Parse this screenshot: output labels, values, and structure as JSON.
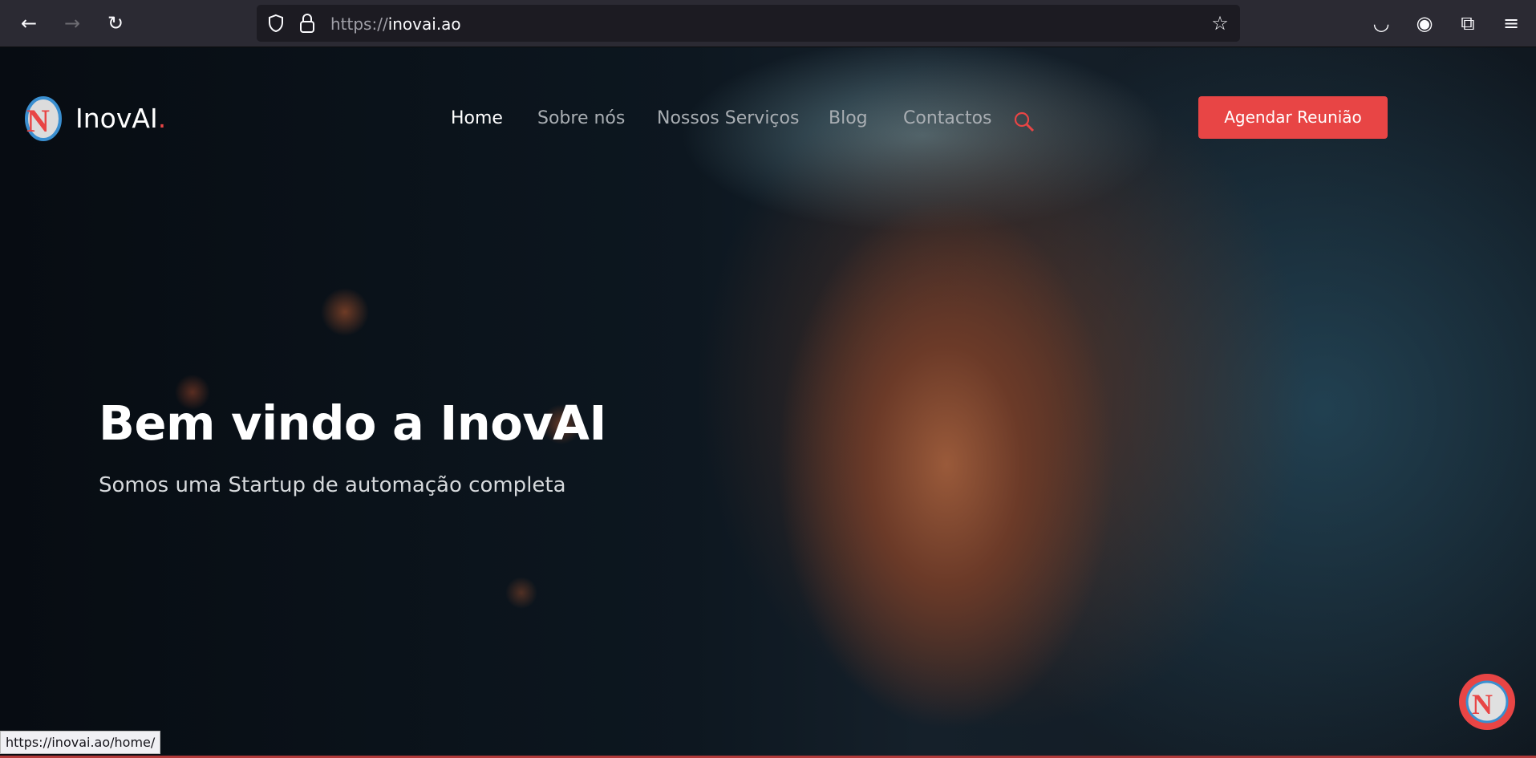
{
  "browser": {
    "url_scheme": "https://",
    "url_host": "inovai.ao",
    "status_url": "https://inovai.ao/home/"
  },
  "site": {
    "brand": "InovAI",
    "brand_dot": ".",
    "accent": "#e84545"
  },
  "nav": {
    "items": [
      {
        "label": "Home",
        "active": true
      },
      {
        "label": "Sobre nós"
      },
      {
        "label": "Nossos Serviços"
      },
      {
        "label": "Blog"
      },
      {
        "label": "Contactos"
      }
    ],
    "cta": "Agendar Reunião"
  },
  "hero": {
    "title": "Bem vindo a InovAI",
    "subtitle": "Somos uma Startup de automação completa"
  }
}
